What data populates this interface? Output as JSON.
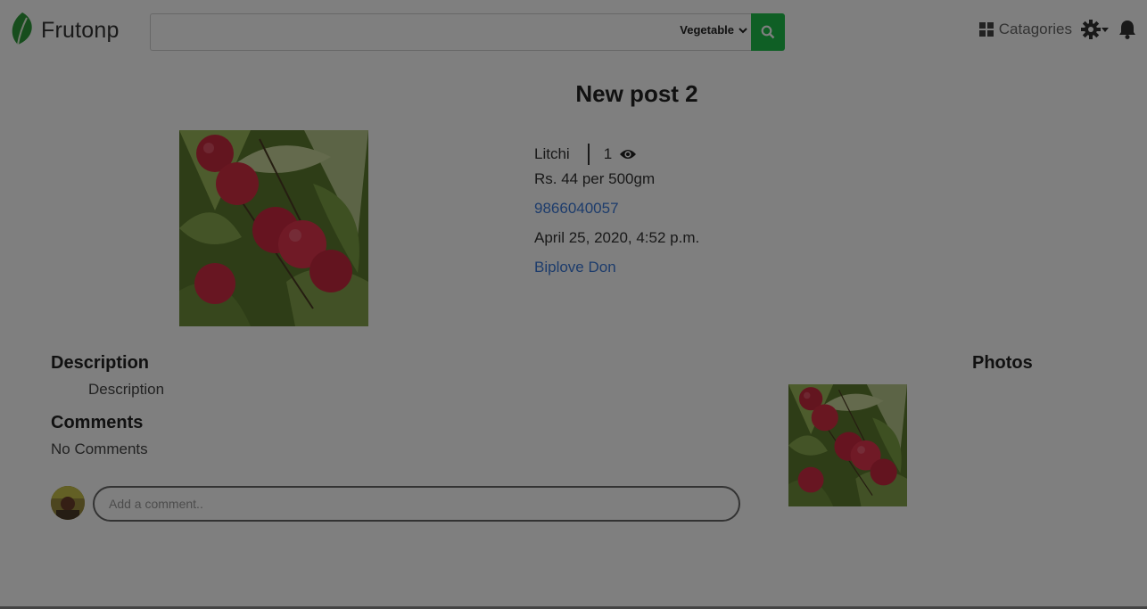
{
  "header": {
    "brand": "Frutonp",
    "search": {
      "value": "",
      "placeholder": ""
    },
    "category_select": "Vegetable",
    "nav": {
      "categories_label": "Catagories"
    }
  },
  "post": {
    "title": "New post 2",
    "product_name": "Litchi",
    "view_count": "1",
    "price": "Rs. 44 per 500gm",
    "phone": "9866040057",
    "date": "April 25, 2020, 4:52 p.m.",
    "author": "Biplove Don"
  },
  "description": {
    "heading": "Description",
    "text": "Description"
  },
  "comments": {
    "heading": "Comments",
    "empty_text": "No Comments",
    "input_placeholder": "Add a comment.."
  },
  "photos": {
    "heading": "Photos"
  },
  "colors": {
    "search_button": "#1fbf4b",
    "link": "#3a79d8",
    "overlay": "rgba(0,0,0,0.5)"
  },
  "icons": {
    "logo": "leaf-icon",
    "search": "search-icon",
    "categories": "grid-icon",
    "settings": "gear-icon",
    "notifications": "bell-icon",
    "views": "eye-icon"
  }
}
